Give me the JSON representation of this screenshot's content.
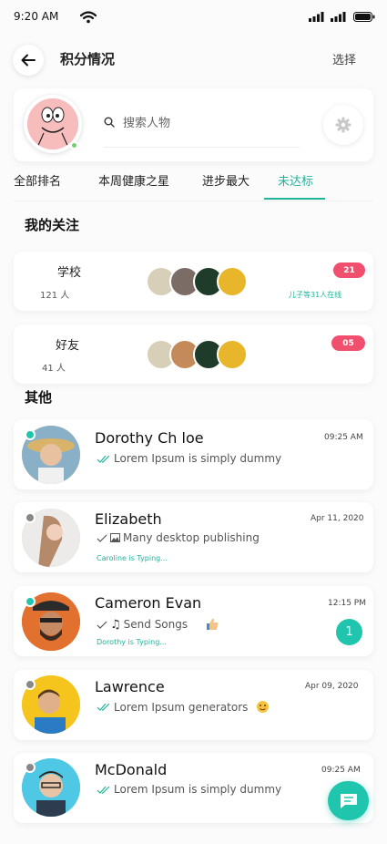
{
  "status_bar": {
    "time": "9:20 AM"
  },
  "header": {
    "title": "积分情况",
    "select_label": "选择"
  },
  "search": {
    "placeholder": "搜索人物"
  },
  "tabs": [
    {
      "label": "全部排名"
    },
    {
      "label": "本周健康之星"
    },
    {
      "label": "进步最大"
    },
    {
      "label": "未达标",
      "active": true
    }
  ],
  "following": {
    "title": "我的关注",
    "groups": [
      {
        "name": "学校",
        "count": "121 人",
        "badge": "21",
        "note": "儿子等31人在线"
      },
      {
        "name": "好友",
        "count": "41 人",
        "badge": "05",
        "note": ""
      }
    ]
  },
  "others": {
    "title": "其他",
    "chats": [
      {
        "name": "Dorothy Ch loe",
        "time": "09:25 AM",
        "message": "Lorem Ipsum is simply dummy",
        "typing": "",
        "online": true
      },
      {
        "name": "Elizabeth",
        "time": "Apr 11, 2020",
        "message": "Many desktop publishing",
        "typing": "Caroline is Typing...",
        "online": false
      },
      {
        "name": "Cameron Evan",
        "time": "12:15 PM",
        "message": "Send Songs",
        "typing": "Dorothy is Typing...",
        "online": true,
        "unread": "1"
      },
      {
        "name": "Lawrence",
        "time": "Apr 09, 2020",
        "message": "Lorem Ipsum generators",
        "typing": "",
        "online": false
      },
      {
        "name": "McDonald",
        "time": "09:25 AM",
        "message": "Lorem Ipsum is simply dummy",
        "typing": "",
        "online": false
      }
    ]
  },
  "colors": {
    "accent": "#20b39c",
    "badge": "#f0506e",
    "online": "#20c5ae"
  },
  "icons": [
    "back-arrow-icon",
    "search-icon",
    "gear-icon",
    "double-check-icon",
    "single-check-icon",
    "image-icon",
    "music-note-icon",
    "chat-icon"
  ]
}
